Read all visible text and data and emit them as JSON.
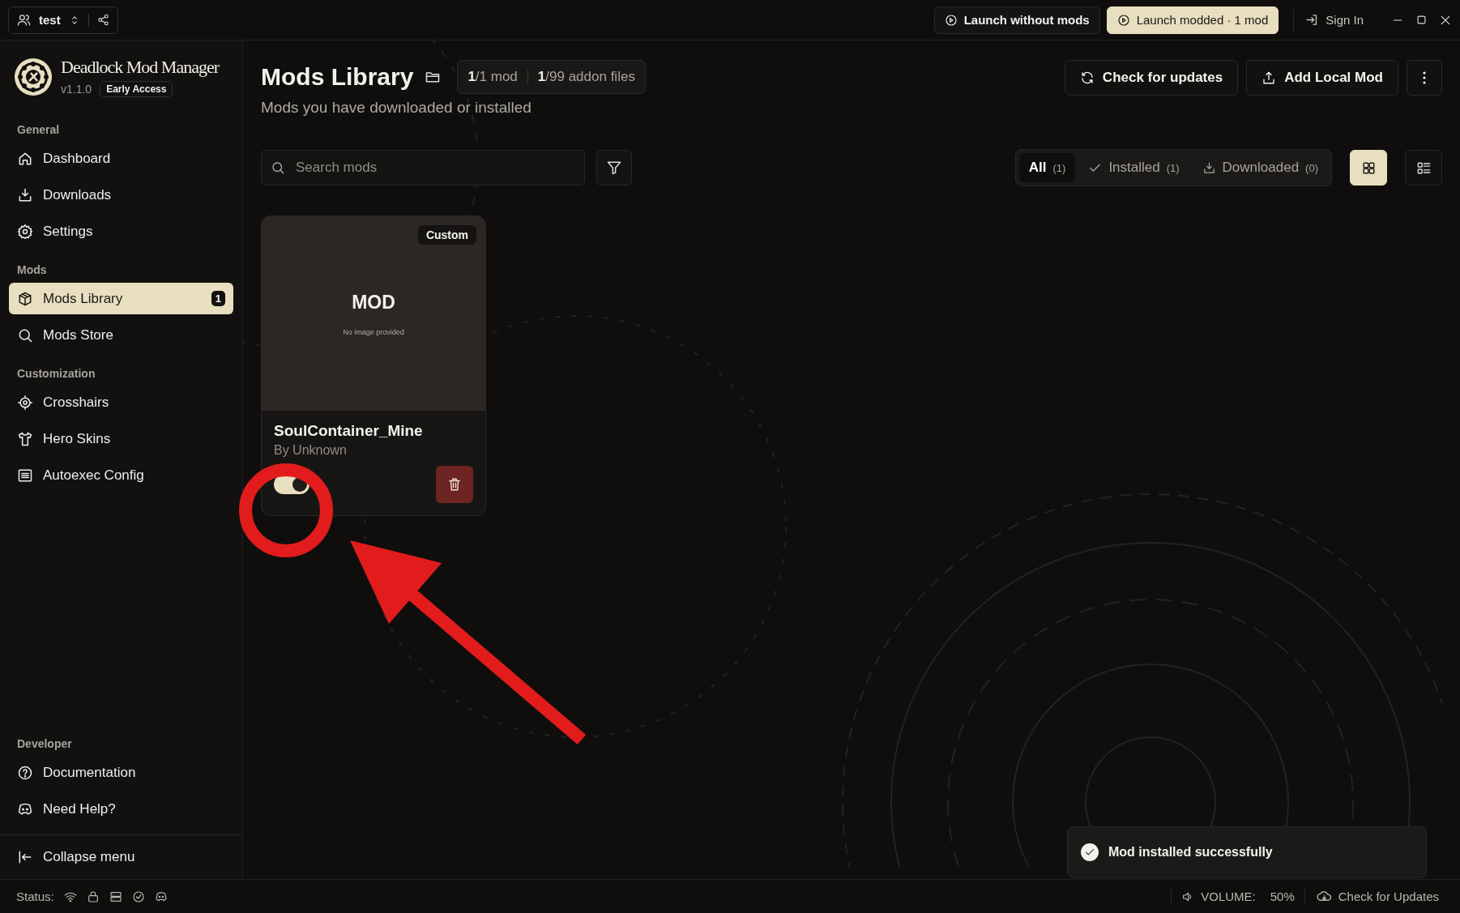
{
  "profile": {
    "name": "test"
  },
  "launch_buttons": [
    {
      "label": "Launch without mods",
      "kind": "outline"
    },
    {
      "label": "Launch modded · 1 mod",
      "kind": "primary"
    }
  ],
  "sign_in": "Sign In",
  "app": {
    "name": "Deadlock Mod Manager",
    "version": "v1.1.0",
    "badge": "Early Access"
  },
  "sidebar": {
    "sections": [
      {
        "title": "General",
        "items": [
          {
            "label": "Dashboard",
            "kind": "home",
            "selected": false
          },
          {
            "label": "Downloads",
            "kind": "download",
            "selected": false
          },
          {
            "label": "Settings",
            "kind": "gear",
            "selected": false
          }
        ]
      },
      {
        "title": "Mods",
        "items": [
          {
            "label": "Mods Library",
            "kind": "box",
            "selected": true,
            "badge": "1"
          },
          {
            "label": "Mods Store",
            "kind": "search",
            "selected": false
          }
        ]
      },
      {
        "title": "Customization",
        "items": [
          {
            "label": "Crosshairs",
            "kind": "crosshair",
            "selected": false
          },
          {
            "label": "Hero Skins",
            "kind": "shirt",
            "selected": false
          },
          {
            "label": "Autoexec Config",
            "kind": "list",
            "selected": false
          }
        ]
      }
    ],
    "footer_sections": [
      {
        "title": "Developer",
        "items": [
          {
            "label": "Documentation",
            "kind": "help",
            "selected": false
          },
          {
            "label": "Need Help?",
            "kind": "chat",
            "selected": false
          }
        ]
      }
    ],
    "collapse": "Collapse menu"
  },
  "page": {
    "title": "Mods Library",
    "subtitle": "Mods you have downloaded or installed",
    "stats": [
      "**1**/1 mod",
      "**1**/99 addon files"
    ],
    "actions": [
      "Check for updates",
      "Add Local Mod"
    ]
  },
  "search": {
    "placeholder": "Search mods"
  },
  "filters": [
    {
      "label": "All",
      "count": "(1)",
      "kind": "all",
      "selected": true
    },
    {
      "label": "Installed",
      "count": "(1)",
      "kind": "check",
      "selected": false
    },
    {
      "label": "Downloaded",
      "count": "(0)",
      "kind": "download",
      "selected": false
    }
  ],
  "view_modes": [
    {
      "kind": "grid",
      "selected": true
    },
    {
      "kind": "list",
      "selected": false
    }
  ],
  "mods": [
    {
      "tag": "Custom",
      "placeholder_title": "MOD",
      "placeholder_note": "No image provided",
      "name": "SoulContainer_Mine",
      "author": "By Unknown",
      "enabled": true
    }
  ],
  "toast": {
    "message": "Mod installed successfully"
  },
  "status_bar": {
    "label": "Status:",
    "volume_label": "VOLUME:",
    "volume": "50%",
    "update": "Check for Updates"
  }
}
